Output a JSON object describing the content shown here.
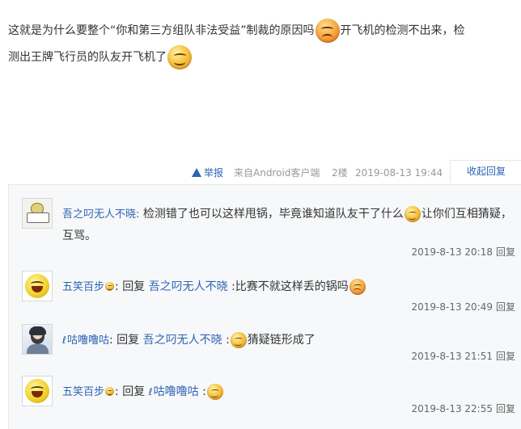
{
  "post": {
    "text_a": "这就是为什么要整个“你和第三方组队非法受益”制裁的原因吗",
    "text_b": "开飞机的检测不出来，检",
    "text_c": "测出王牌飞行员的队友开飞机了"
  },
  "meta": {
    "report": "举报",
    "from": "来自Android客户端",
    "floor": "2楼",
    "time": "2019-08-13 19:44",
    "collapse": "收起回复"
  },
  "replies": [
    {
      "user": "吾之叼无人不晓:",
      "text": "检测错了也可以这样甩锅，毕竟谁知道队友干了什么",
      "text_after": "让你们互相猜疑，互骂。",
      "time": "2019-8-13 20:18",
      "reply": "回复"
    },
    {
      "user": "五笑百步",
      "colon": ":",
      "reply_word": "回复",
      "target": "吾之叼无人不晓",
      "text": ":比赛不就这样丢的锅吗",
      "time": "2019-8-13 20:49",
      "reply": "回复"
    },
    {
      "user": "咕噜噜咕",
      "colon": ":",
      "reply_word": "回复",
      "target": "吾之叼无人不晓",
      "text_before": ":",
      "text": "猜疑链形成了",
      "time": "2019-8-13 21:51",
      "reply": "回复"
    },
    {
      "user": "五笑百步",
      "colon": ":",
      "reply_word": "回复",
      "target": "咕噜噜咕",
      "text_before": ":",
      "time": "2019-8-13 22:55",
      "reply": "回复"
    }
  ]
}
